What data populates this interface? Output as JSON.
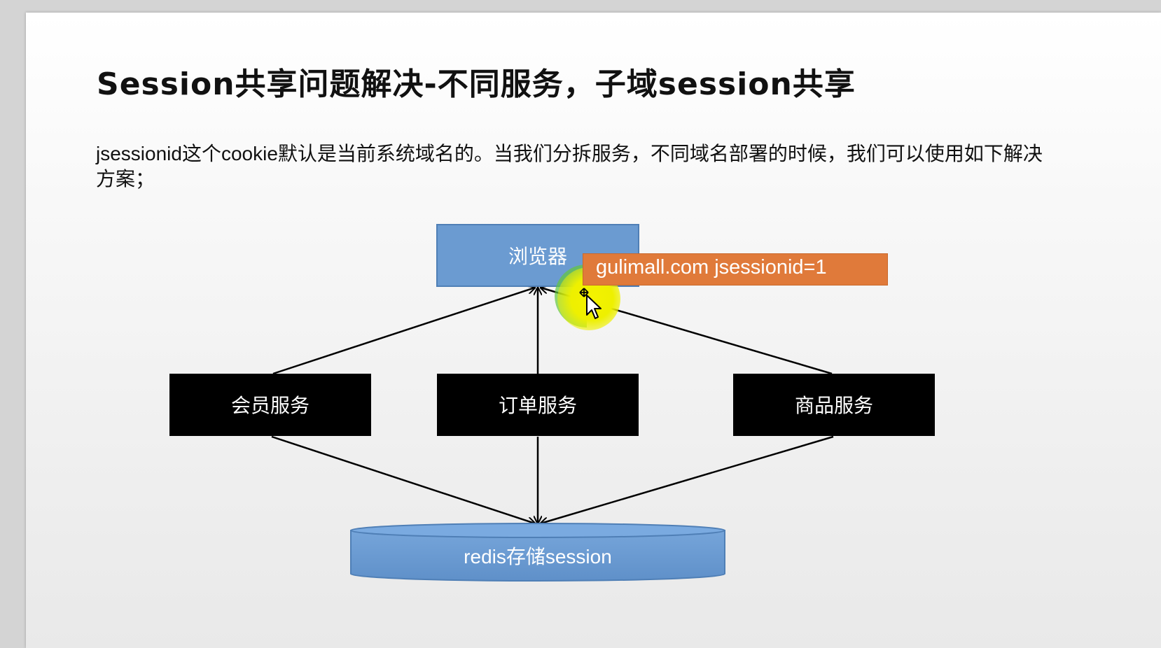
{
  "slide": {
    "title": "Session共享问题解决-不同服务，子域session共享",
    "description": "jsessionid这个cookie默认是当前系统域名的。当我们分拆服务，不同域名部署的时候，我们可以使用如下解决方案；"
  },
  "diagram": {
    "nodes": {
      "browser": "浏览器",
      "member_service": "会员服务",
      "order_service": "订单服务",
      "product_service": "商品服务",
      "redis": "redis存储session"
    },
    "callout": "gulimall.com  jsessionid=1"
  },
  "colors": {
    "browser_box": "#6b9bd1",
    "service_box": "#000000",
    "redis_cylinder": "#6b9bd1",
    "callout": "#e07a3a",
    "highlight": "#eef000"
  }
}
